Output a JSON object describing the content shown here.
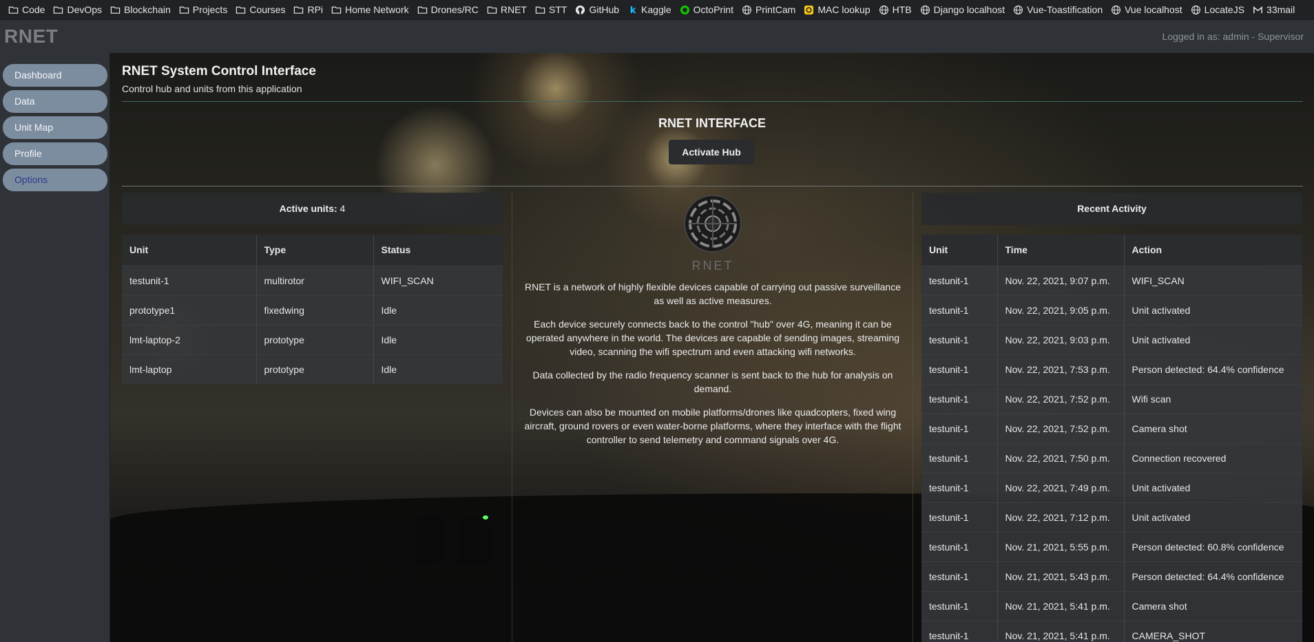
{
  "bookmarks": [
    {
      "label": "Code",
      "icon": "folder-icon"
    },
    {
      "label": "DevOps",
      "icon": "folder-icon"
    },
    {
      "label": "Blockchain",
      "icon": "folder-icon"
    },
    {
      "label": "Projects",
      "icon": "folder-icon"
    },
    {
      "label": "Courses",
      "icon": "folder-icon"
    },
    {
      "label": "RPi",
      "icon": "folder-icon"
    },
    {
      "label": "Home Network",
      "icon": "folder-icon"
    },
    {
      "label": "Drones/RC",
      "icon": "folder-icon"
    },
    {
      "label": "RNET",
      "icon": "folder-icon"
    },
    {
      "label": "STT",
      "icon": "folder-icon"
    },
    {
      "label": "GitHub",
      "icon": "github-icon"
    },
    {
      "label": "Kaggle",
      "icon": "kaggle-icon"
    },
    {
      "label": "OctoPrint",
      "icon": "octoprint-icon"
    },
    {
      "label": "PrintCam",
      "icon": "globe-icon"
    },
    {
      "label": "MAC lookup",
      "icon": "mac-lookup-icon"
    },
    {
      "label": "HTB",
      "icon": "globe-icon"
    },
    {
      "label": "Django localhost",
      "icon": "globe-icon"
    },
    {
      "label": "Vue-Toastification",
      "icon": "globe-icon"
    },
    {
      "label": "Vue localhost",
      "icon": "globe-icon"
    },
    {
      "label": "LocateJS",
      "icon": "globe-icon"
    },
    {
      "label": "33mail",
      "icon": "mail-icon"
    }
  ],
  "topbar": {
    "brand": "RNET",
    "login": "Logged in as: admin - Supervisor"
  },
  "sidebar": {
    "items": [
      {
        "label": "Dashboard"
      },
      {
        "label": "Data"
      },
      {
        "label": "Unit Map"
      },
      {
        "label": "Profile"
      },
      {
        "label": "Options"
      }
    ]
  },
  "header": {
    "title": "RNET System Control Interface",
    "subtitle": "Control hub and units from this application"
  },
  "interface": {
    "title": "RNET INTERFACE",
    "activate_hub": "Activate Hub"
  },
  "units_panel": {
    "label": "Active units:",
    "count": "4",
    "columns": [
      "Unit",
      "Type",
      "Status"
    ],
    "rows": [
      [
        "testunit-1",
        "multirotor",
        "WIFI_SCAN"
      ],
      [
        "prototype1",
        "fixedwing",
        "Idle"
      ],
      [
        "lmt-laptop-2",
        "prototype",
        "Idle"
      ],
      [
        "lmt-laptop",
        "prototype",
        "Idle"
      ]
    ]
  },
  "about": {
    "logo_text": "RNET",
    "paragraphs": [
      "RNET is a network of highly flexible devices capable of carrying out passive surveillance as well as active measures.",
      "Each device securely connects back to the control \"hub\" over 4G, meaning it can be operated anywhere in the world. The devices are capable of sending images, streaming video, scanning the wifi spectrum and even attacking wifi networks.",
      "Data collected by the radio frequency scanner is sent back to the hub for analysis on demand.",
      "Devices can also be mounted on mobile platforms/drones like quadcopters, fixed wing aircraft, ground rovers or even water-borne platforms, where they interface with the flight controller to send telemetry and command signals over 4G."
    ]
  },
  "activity_panel": {
    "title": "Recent Activity",
    "columns": [
      "Unit",
      "Time",
      "Action"
    ],
    "rows": [
      [
        "testunit-1",
        "Nov. 22, 2021, 9:07 p.m.",
        "WIFI_SCAN"
      ],
      [
        "testunit-1",
        "Nov. 22, 2021, 9:05 p.m.",
        "Unit activated"
      ],
      [
        "testunit-1",
        "Nov. 22, 2021, 9:03 p.m.",
        "Unit activated"
      ],
      [
        "testunit-1",
        "Nov. 22, 2021, 7:53 p.m.",
        "Person detected: 64.4% confidence"
      ],
      [
        "testunit-1",
        "Nov. 22, 2021, 7:52 p.m.",
        "Wifi scan"
      ],
      [
        "testunit-1",
        "Nov. 22, 2021, 7:52 p.m.",
        "Camera shot"
      ],
      [
        "testunit-1",
        "Nov. 22, 2021, 7:50 p.m.",
        "Connection recovered"
      ],
      [
        "testunit-1",
        "Nov. 22, 2021, 7:49 p.m.",
        "Unit activated"
      ],
      [
        "testunit-1",
        "Nov. 22, 2021, 7:12 p.m.",
        "Unit activated"
      ],
      [
        "testunit-1",
        "Nov. 21, 2021, 5:55 p.m.",
        "Person detected: 60.8% confidence"
      ],
      [
        "testunit-1",
        "Nov. 21, 2021, 5:43 p.m.",
        "Person detected: 64.4% confidence"
      ],
      [
        "testunit-1",
        "Nov. 21, 2021, 5:41 p.m.",
        "Camera shot"
      ],
      [
        "testunit-1",
        "Nov. 21, 2021, 5:41 p.m.",
        "CAMERA_SHOT"
      ]
    ]
  },
  "colors": {
    "sidebar_button": "#7d8da0",
    "sidebar_active_text": "#2a3a8c",
    "divider": "#3e6b66",
    "background": "#2f3337"
  }
}
